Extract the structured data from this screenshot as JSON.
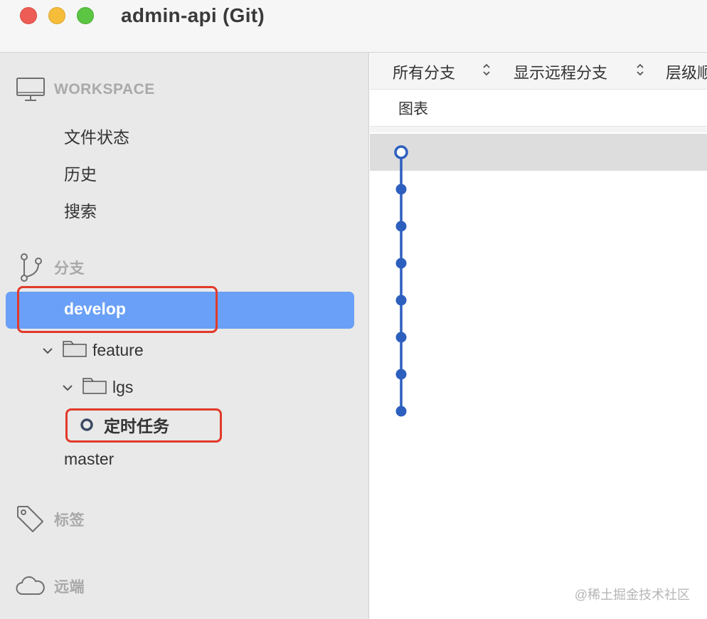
{
  "window": {
    "title": "admin-api (Git)"
  },
  "sidebar": {
    "workspace": {
      "header": "WORKSPACE",
      "items": [
        "文件状态",
        "历史",
        "搜索"
      ]
    },
    "branches": {
      "header": "分支",
      "selected": "develop",
      "folder1": "feature",
      "folder2": "lgs",
      "current_branch": "定时任务",
      "other": "master"
    },
    "tags": {
      "header": "标签"
    },
    "remotes": {
      "header": "远端"
    }
  },
  "toolbar": {
    "filter_all": "所有分支",
    "filter_remote": "显示远程分支",
    "filter_order": "层级顺"
  },
  "columns": {
    "graph": "图表"
  },
  "graph": {
    "commit_count": 8,
    "color": "#2d5fbf"
  },
  "watermark": "@稀土掘金技术社区",
  "colors": {
    "accent": "#6aa0f7",
    "highlight_box": "#e23a2a"
  }
}
